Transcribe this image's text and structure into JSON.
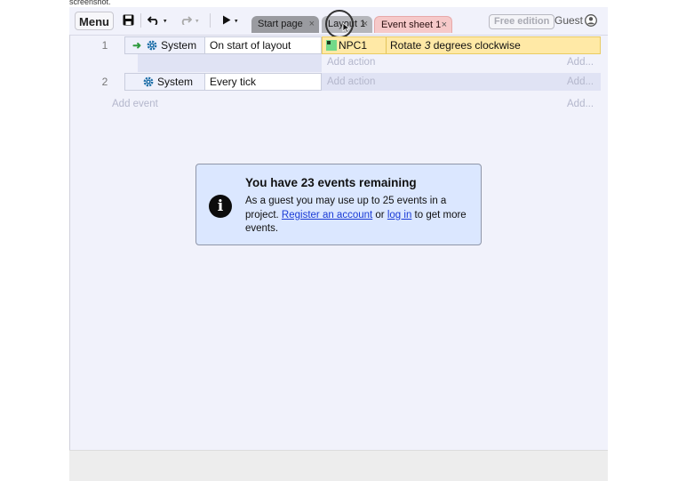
{
  "top_clip_text": "screenshot.",
  "toolbar": {
    "menu_label": "Menu",
    "save_icon": "save-icon",
    "undo_icon": "undo-icon",
    "redo_icon": "redo-icon",
    "play_icon": "play-icon"
  },
  "tabs": [
    {
      "label": "Start page",
      "close": "×"
    },
    {
      "label": "Layout 1",
      "close": "×"
    },
    {
      "label": "Event sheet 1",
      "close": "×"
    }
  ],
  "edition_badge": "Free edition",
  "user_label": "Guest",
  "events": [
    {
      "number": "1",
      "condition_object": "System",
      "condition_text": "On start of layout",
      "action_object": "NPC1",
      "action_text_before": "Rotate ",
      "action_text_em": "3",
      "action_text_after": " degrees clockwise",
      "add_action": "Add action",
      "add_more": "Add..."
    },
    {
      "number": "2",
      "condition_object": "System",
      "condition_text": "Every tick",
      "add_action": "Add action",
      "add_more": "Add..."
    }
  ],
  "add_event": "Add event",
  "add_event_more": "Add...",
  "notice": {
    "title": "You have 23 events remaining",
    "line1": "As a guest you may use up to 25 events in a project. ",
    "link1": "Register an account",
    "mid": " or ",
    "link2": "log in",
    "line2": " to get more events."
  },
  "colors": {
    "action_highlight": "#ffe9a6",
    "tab_active": "#f6c9c9",
    "notice_bg": "#dbe7ff",
    "link": "#1a3bd6"
  }
}
